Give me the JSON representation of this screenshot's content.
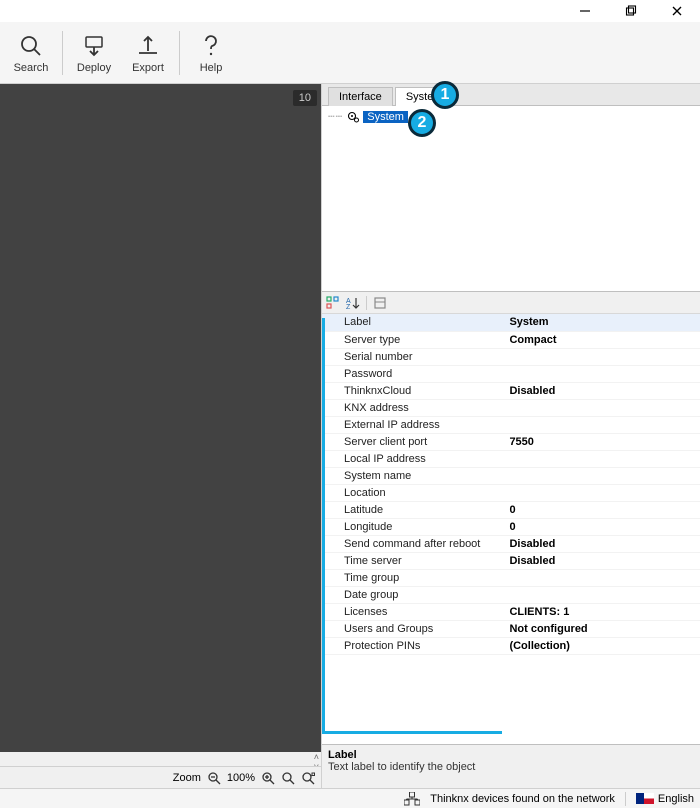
{
  "toolbar": {
    "search": "Search",
    "deploy": "Deploy",
    "export": "Export",
    "help": "Help"
  },
  "canvas": {
    "corner_label": "10"
  },
  "tabs": {
    "interface": "Interface",
    "system": "System"
  },
  "tree": {
    "node_label": "System"
  },
  "callouts": {
    "one": "1",
    "two": "2"
  },
  "properties": [
    {
      "label": "Label",
      "value": "System",
      "selected": true
    },
    {
      "label": "Server type",
      "value": "Compact"
    },
    {
      "label": "Serial number",
      "value": ""
    },
    {
      "label": "Password",
      "value": ""
    },
    {
      "label": "ThinknxCloud",
      "value": "Disabled"
    },
    {
      "label": "KNX address",
      "value": ""
    },
    {
      "label": "External IP address",
      "value": ""
    },
    {
      "label": "Server client port",
      "value": "7550"
    },
    {
      "label": "Local IP address",
      "value": ""
    },
    {
      "label": "System name",
      "value": ""
    },
    {
      "label": "Location",
      "value": ""
    },
    {
      "label": "Latitude",
      "value": "0"
    },
    {
      "label": "Longitude",
      "value": "0"
    },
    {
      "label": "Send command after reboot",
      "value": "Disabled"
    },
    {
      "label": "Time server",
      "value": "Disabled"
    },
    {
      "label": "Time group",
      "value": ""
    },
    {
      "label": "Date group",
      "value": ""
    },
    {
      "label": "Licenses",
      "value": "CLIENTS: 1"
    },
    {
      "label": "Users and Groups",
      "value": "Not configured"
    },
    {
      "label": "Protection PINs",
      "value": "(Collection)"
    }
  ],
  "description": {
    "title": "Label",
    "text": "Text label to identify the object"
  },
  "zoom": {
    "label": "Zoom",
    "value": "100%"
  },
  "status": {
    "network_text": "Thinknx devices found on the network",
    "language": "English"
  }
}
